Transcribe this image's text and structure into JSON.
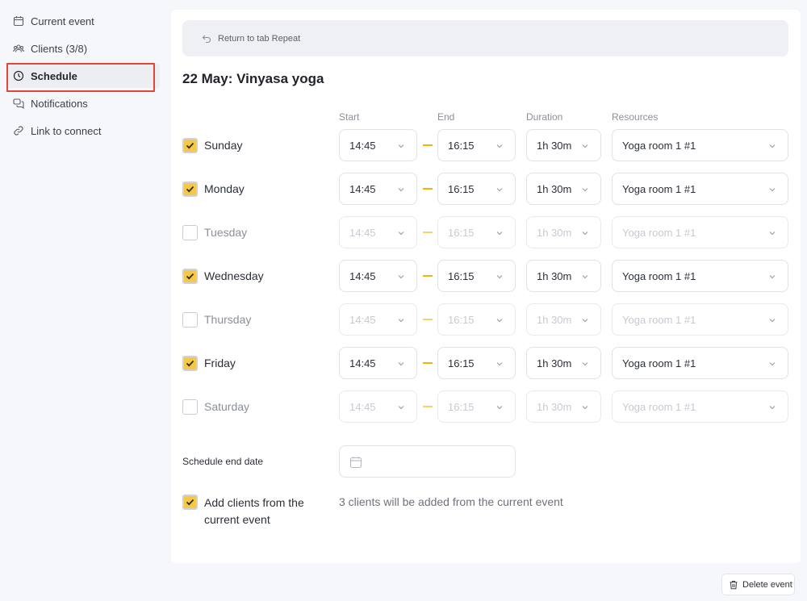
{
  "sidebar": {
    "items": [
      {
        "label": "Current event",
        "icon": "calendar-icon"
      },
      {
        "label": "Clients (3/8)",
        "icon": "users-icon"
      },
      {
        "label": "Schedule",
        "icon": "clock-icon",
        "active": true
      },
      {
        "label": "Notifications",
        "icon": "chat-icon"
      },
      {
        "label": "Link to connect",
        "icon": "link-icon"
      }
    ]
  },
  "return_bar": {
    "label": "Return to tab Repeat",
    "icon": "undo-icon"
  },
  "title": "22 May: Vinyasa yoga",
  "columns": {
    "start": "Start",
    "end": "End",
    "duration": "Duration",
    "resources": "Resources"
  },
  "days": [
    {
      "name": "Sunday",
      "checked": true,
      "start": "14:45",
      "end": "16:15",
      "duration": "1h 30m",
      "resource": "Yoga room 1 #1"
    },
    {
      "name": "Monday",
      "checked": true,
      "start": "14:45",
      "end": "16:15",
      "duration": "1h 30m",
      "resource": "Yoga room 1 #1"
    },
    {
      "name": "Tuesday",
      "checked": false,
      "start": "14:45",
      "end": "16:15",
      "duration": "1h 30m",
      "resource": "Yoga room 1 #1"
    },
    {
      "name": "Wednesday",
      "checked": true,
      "start": "14:45",
      "end": "16:15",
      "duration": "1h 30m",
      "resource": "Yoga room 1 #1"
    },
    {
      "name": "Thursday",
      "checked": false,
      "start": "14:45",
      "end": "16:15",
      "duration": "1h 30m",
      "resource": "Yoga room 1 #1"
    },
    {
      "name": "Friday",
      "checked": true,
      "start": "14:45",
      "end": "16:15",
      "duration": "1h 30m",
      "resource": "Yoga room 1 #1"
    },
    {
      "name": "Saturday",
      "checked": false,
      "start": "14:45",
      "end": "16:15",
      "duration": "1h 30m",
      "resource": "Yoga room 1 #1"
    }
  ],
  "schedule_end": {
    "label": "Schedule end date",
    "value": "",
    "icon": "calendar-icon"
  },
  "add_clients": {
    "checked": true,
    "label": "Add clients from the current event",
    "note": "3 clients will be added from the current event"
  },
  "delete_button": {
    "label": "Delete event",
    "icon": "trash-icon"
  },
  "colors": {
    "accent": "#f7c844",
    "dash": "#f2b705",
    "highlight_border": "#e0473a",
    "background": "#f6f7fa"
  }
}
